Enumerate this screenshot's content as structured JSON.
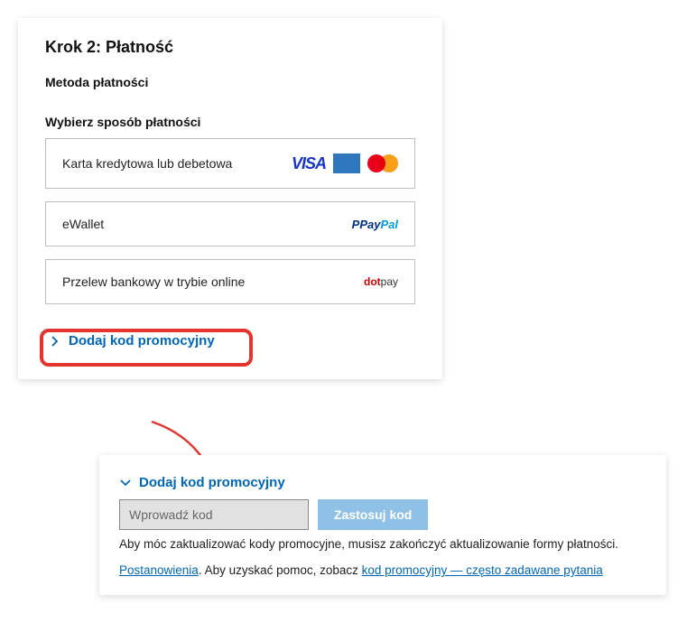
{
  "step": {
    "title": "Krok 2: Płatność"
  },
  "payment": {
    "sectionTitle": "Metoda płatności",
    "chooseLabel": "Wybierz sposób płatności",
    "options": [
      {
        "label": "Karta kredytowa lub debetowa"
      },
      {
        "label": "eWallet"
      },
      {
        "label": "Przelew bankowy w trybie online"
      }
    ]
  },
  "promo": {
    "toggleLabel": "Dodaj kod promocyjny",
    "inputPlaceholder": "Wprowadź kod",
    "applyLabel": "Zastosuj kod",
    "note": "Aby móc zaktualizować kody promocyjne, musisz zakończyć aktualizowanie formy płatności.",
    "termsLink": "Postanowienia",
    "termsMiddle": ". Aby uzyskać pomoc, zobacz ",
    "faqLink": "kod promocyjny — często zadawane pytania"
  },
  "logos": {
    "visa": "VISA",
    "paypalP": "P",
    "paypalPay": "Pay",
    "paypalPal": "Pal",
    "dotpayDot": "dot",
    "dotpayPay": "pay"
  }
}
